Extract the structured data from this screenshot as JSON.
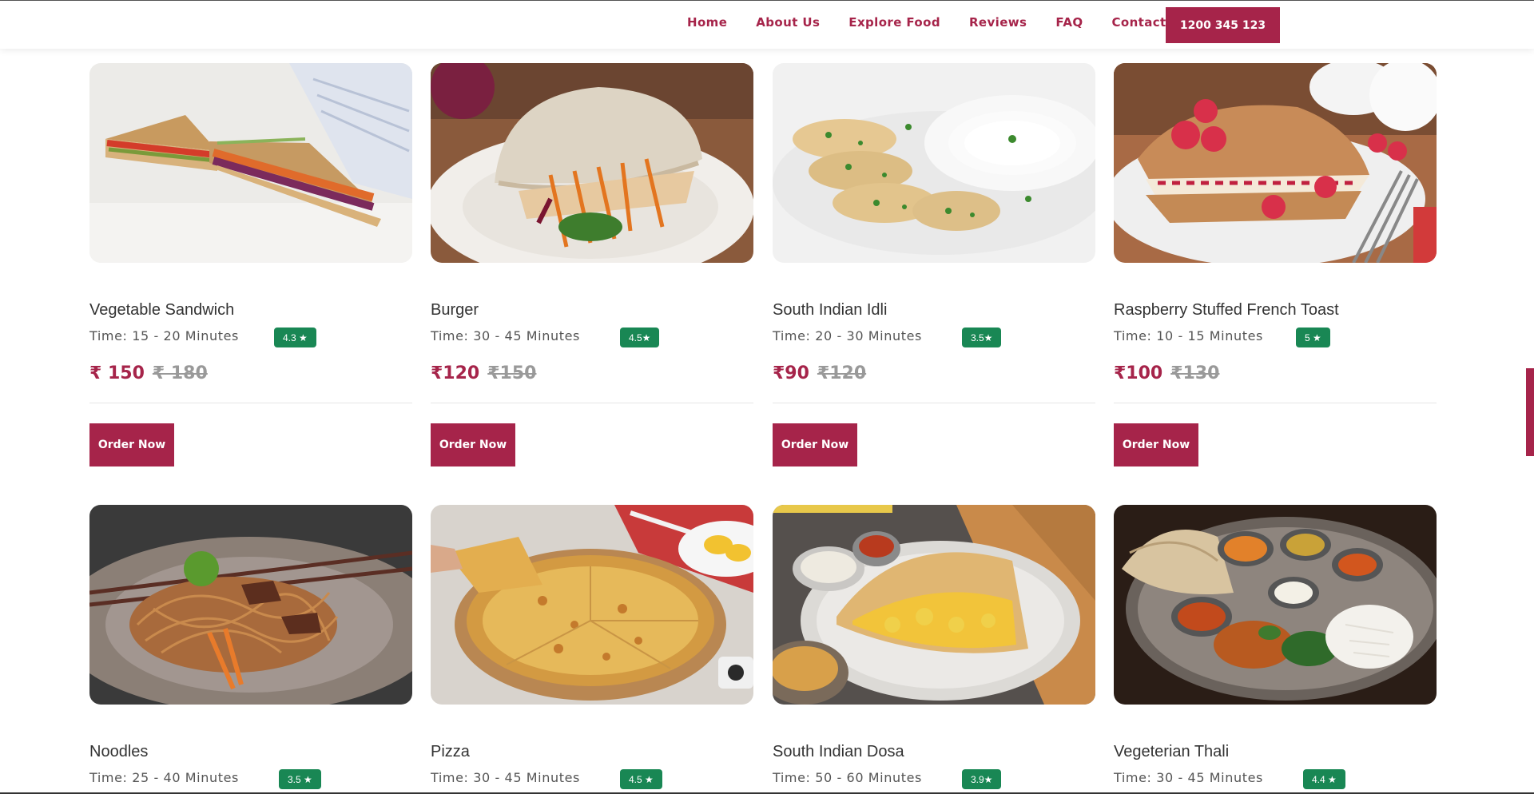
{
  "nav": {
    "links": [
      "Home",
      "About Us",
      "Explore Food",
      "Reviews",
      "FAQ",
      "Contact"
    ],
    "phone": "1200 345 123"
  },
  "order_label": "Order Now",
  "colors": {
    "accent": "#a6244a",
    "rating_badge": "#198754"
  },
  "foods": [
    {
      "name": "Vegetable Sandwich",
      "time": "Time: 15 - 20 Minutes",
      "rating": "4.3 ★",
      "price": "₹ 150",
      "old_price": "₹ 180"
    },
    {
      "name": "Burger",
      "time": "Time: 30 - 45 Minutes",
      "rating": "4.5★",
      "price": "₹120",
      "old_price": "₹150"
    },
    {
      "name": "South Indian Idli",
      "time": "Time: 20 - 30 Minutes",
      "rating": "3.5★",
      "price": "₹90",
      "old_price": "₹120"
    },
    {
      "name": "Raspberry Stuffed French Toast",
      "time": "Time: 10 - 15 Minutes",
      "rating": "5 ★",
      "price": "₹100",
      "old_price": "₹130"
    },
    {
      "name": "Noodles",
      "time": "Time: 25 - 40 Minutes",
      "rating": "3.5 ★",
      "price": "",
      "old_price": ""
    },
    {
      "name": "Pizza",
      "time": "Time: 30 - 45 Minutes",
      "rating": "4.5 ★",
      "price": "",
      "old_price": ""
    },
    {
      "name": "South Indian Dosa",
      "time": "Time: 50 - 60 Minutes",
      "rating": "3.9★",
      "price": "",
      "old_price": ""
    },
    {
      "name": "Vegeterian Thali",
      "time": "Time: 30 - 45 Minutes",
      "rating": "4.4 ★",
      "price": "",
      "old_price": ""
    }
  ]
}
